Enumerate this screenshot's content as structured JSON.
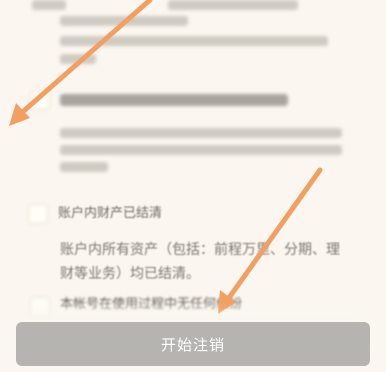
{
  "section": {
    "item_title": "账户内财产已结清",
    "item_desc": "账户内所有资产（包括：前程万里、分期、理财等业务）均已结清。",
    "bottom_text": "本帐号在使用过程中无任何纠纷"
  },
  "footer": {
    "start_button_label": "开始注销"
  },
  "colors": {
    "background": "#fbf7f0",
    "button_bg": "#b6b4b0",
    "arrow": "#f2a062"
  }
}
